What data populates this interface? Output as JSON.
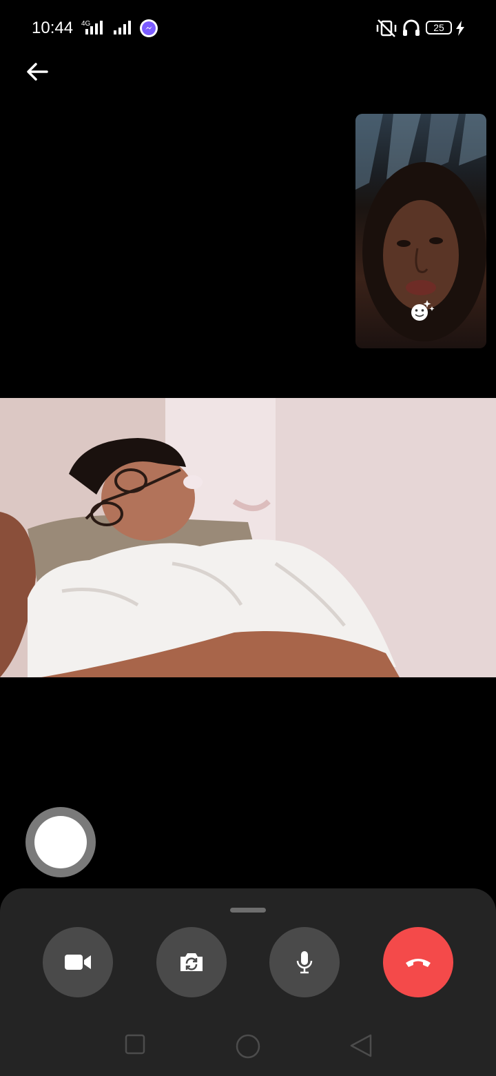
{
  "status_bar": {
    "time": "10:44",
    "network_type": "4G",
    "battery_level": "25",
    "icons": [
      "signal-icon",
      "messenger-icon",
      "mute-icon",
      "headphones-icon",
      "battery-icon",
      "charging-icon"
    ]
  },
  "header": {
    "back_icon": "arrow-left-icon"
  },
  "call": {
    "self_view_effects_icon": "smiley-sparkle-icon"
  },
  "controls": {
    "items": [
      {
        "name": "camera",
        "icon": "video-camera-icon"
      },
      {
        "name": "flip",
        "icon": "camera-flip-icon"
      },
      {
        "name": "mic",
        "icon": "microphone-icon"
      },
      {
        "name": "end",
        "icon": "phone-hangup-icon"
      }
    ],
    "colors": {
      "end_call": "#f44a4a",
      "button": "#4a4a4a",
      "sheet": "#242424"
    }
  },
  "nav_bar": {
    "icons": [
      "recent-apps-icon",
      "home-icon",
      "back-triangle-icon"
    ]
  }
}
